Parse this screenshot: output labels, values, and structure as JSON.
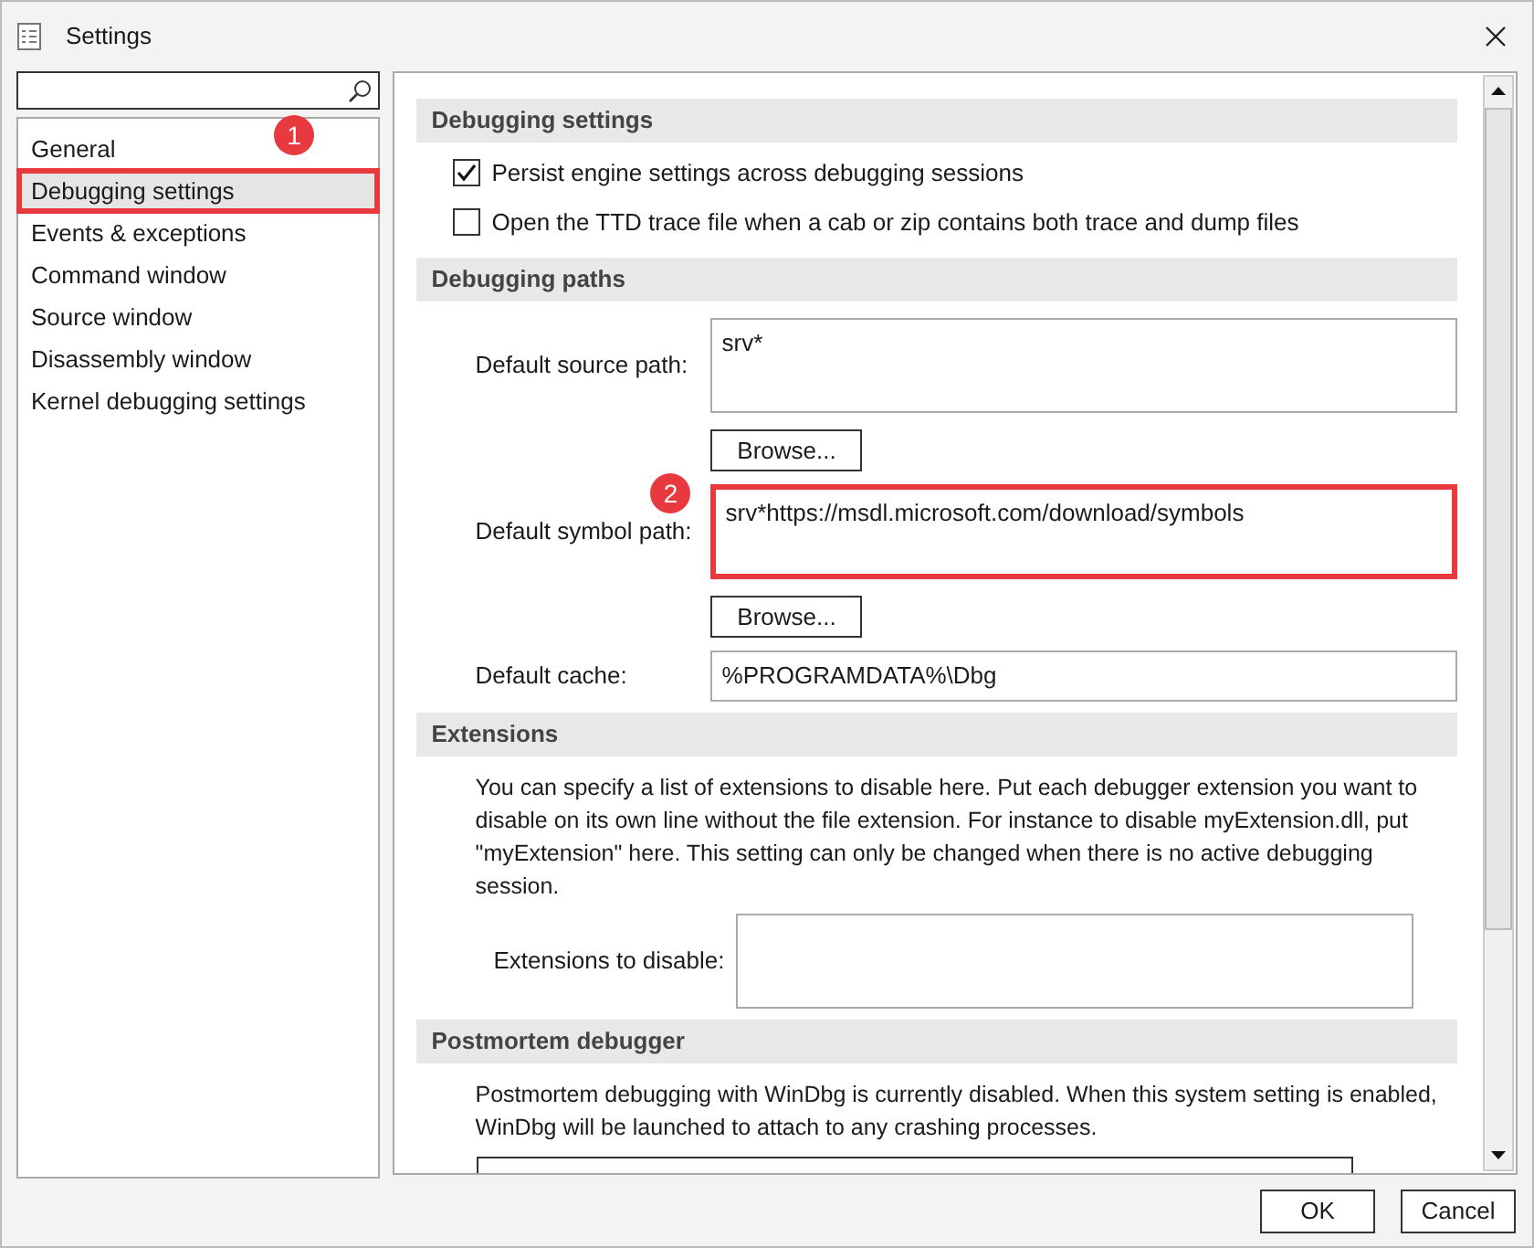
{
  "window": {
    "title": "Settings"
  },
  "nav_items": [
    {
      "label": "General",
      "selected": false
    },
    {
      "label": "Debugging settings",
      "selected": true,
      "callout": "1"
    },
    {
      "label": "Events & exceptions",
      "selected": false
    },
    {
      "label": "Command window",
      "selected": false
    },
    {
      "label": "Source window",
      "selected": false
    },
    {
      "label": "Disassembly window",
      "selected": false
    },
    {
      "label": "Kernel debugging settings",
      "selected": false
    }
  ],
  "sections": [
    {
      "title": "Debugging settings",
      "items": [
        {
          "kind": "checkbox",
          "label": "Persist engine settings across debugging sessions",
          "checked": true
        },
        {
          "kind": "checkbox",
          "label": "Open the TTD trace file when a cab or zip contains both trace and dump files",
          "checked": false
        }
      ]
    },
    {
      "title": "Debugging paths",
      "items": [
        {
          "kind": "multiline",
          "label": "Default source path:",
          "value": "srv*",
          "button": "Browse..."
        },
        {
          "kind": "multiline",
          "label": "Default symbol path:",
          "value": "srv*https://msdl.microsoft.com/download/symbols",
          "button": "Browse...",
          "callout": "2"
        },
        {
          "kind": "text",
          "label": "Default cache:",
          "value": "%PROGRAMDATA%\\Dbg"
        }
      ]
    },
    {
      "title": "Extensions",
      "items": [
        {
          "kind": "paragraph",
          "text": "You can specify a list of extensions to disable here. Put each debugger extension you want to disable on its own line without the file extension. For instance to disable myExtension.dll, put \"myExtension\" here. This setting can only be changed when there is no active debugging session."
        },
        {
          "kind": "textarea",
          "label": "Extensions to disable:"
        }
      ]
    },
    {
      "title": "Postmortem debugger",
      "items": [
        {
          "kind": "paragraph",
          "text": "Postmortem debugging with WinDbg is currently disabled. When this system setting is enabled, WinDbg will be launched to attach to any crashing processes."
        },
        {
          "kind": "cut_button"
        }
      ]
    }
  ],
  "buttons": [
    "OK",
    "Cancel"
  ]
}
